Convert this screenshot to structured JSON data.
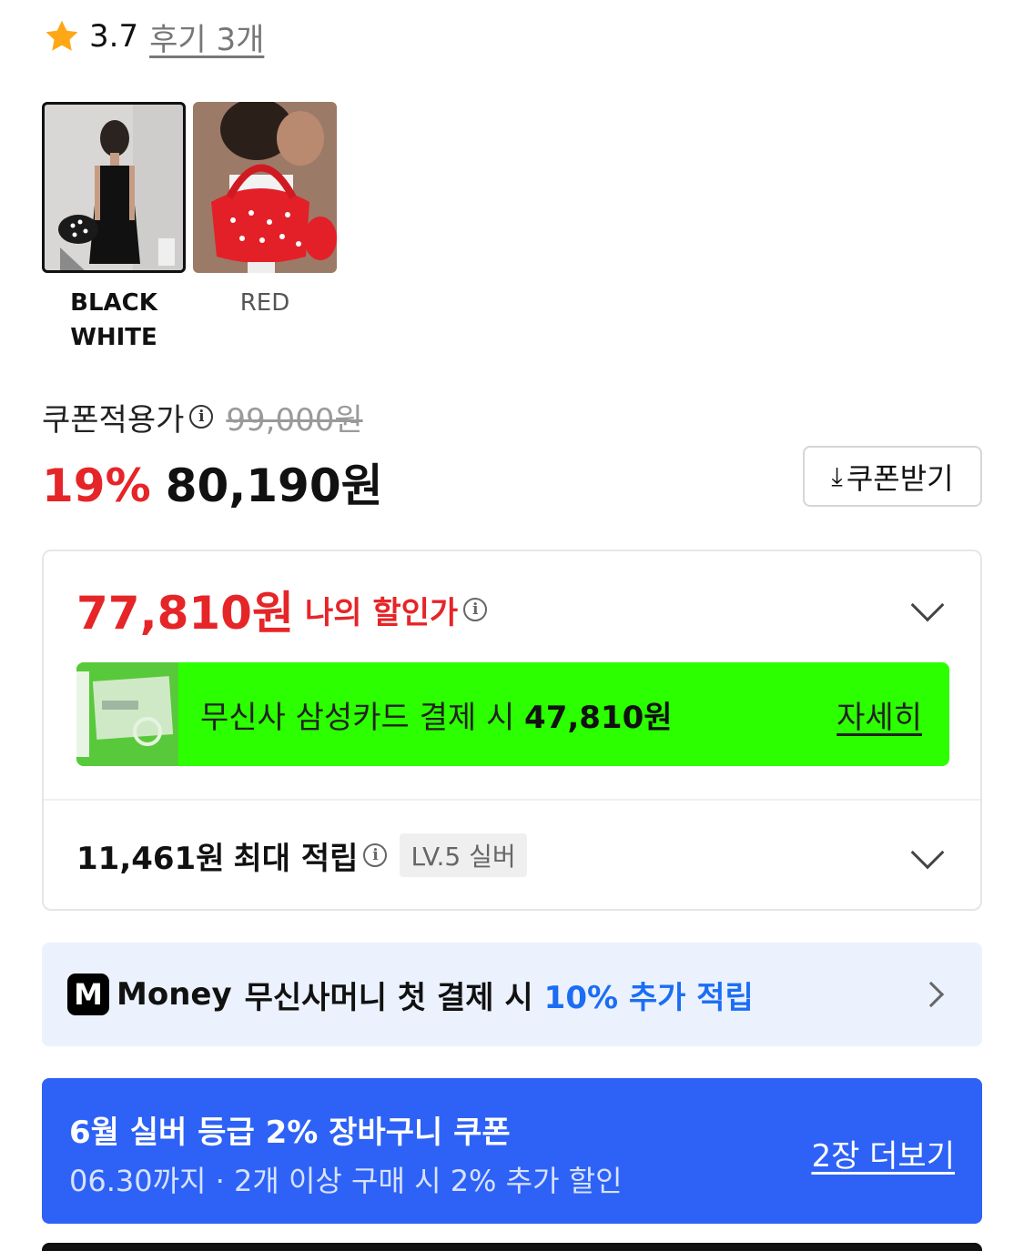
{
  "rating": {
    "score": "3.7",
    "review_link": "후기 3개",
    "icon": "star-icon"
  },
  "options": [
    {
      "label_line1": "BLACK",
      "label_line2": "WHITE",
      "selected": true
    },
    {
      "label_line1": "RED",
      "label_line2": "",
      "selected": false
    }
  ],
  "price": {
    "coupon_label": "쿠폰적용가",
    "original": "99,000원",
    "discount": "19%",
    "current": "80,190원",
    "coupon_button": "쿠폰받기"
  },
  "benefits": {
    "my_price": "77,810원",
    "my_price_label": "나의 할인가",
    "card_text": "무신사 삼성카드 결제 시 ",
    "card_price": "47,810원",
    "card_more": "자세히",
    "points": "11,461원",
    "points_label": "최대 적립",
    "level_badge": "LV.5 실버"
  },
  "money": {
    "logo": "M",
    "brand": "Money",
    "text": "무신사머니 첫 결제 시",
    "highlight": "10% 추가 적립"
  },
  "coupon_banner": {
    "title": "6월 실버 등급 2% 장바구니 쿠폰",
    "subtitle": "06.30까지 · 2개 이상 구매 시 2% 추가 할인",
    "more": "2장 더보기"
  },
  "colors": {
    "accent_red": "#e52528",
    "card_green": "#2bff00",
    "money_blue": "#1b6ef3",
    "coupon_blue": "#2e62f6"
  }
}
